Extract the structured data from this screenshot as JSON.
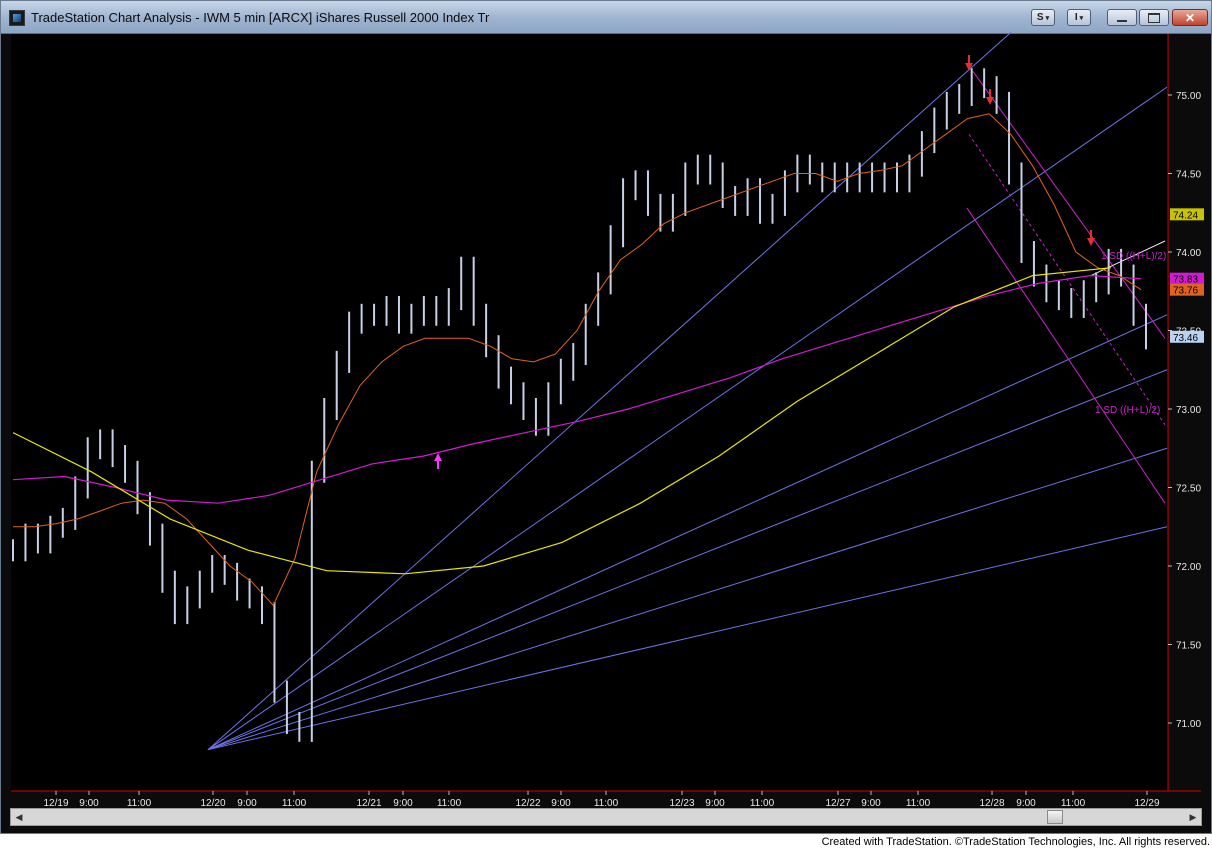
{
  "window": {
    "title": "TradeStation Chart Analysis - IWM 5 min [ARCX] iShares Russell 2000 Index Tr",
    "buttons": {
      "symbol_menu": "S",
      "toolbar_menu": "I"
    }
  },
  "footer": {
    "credit": "Created with TradeStation. ©TradeStation Technologies, Inc. All rights reserved."
  },
  "colors": {
    "background": "#000000",
    "bars": "#c7d1e6",
    "ema_orange": "#e0621f",
    "ma_magenta": "#d21ad2",
    "regression_yellow": "#e6e600",
    "fan_lines": "#6c74e6",
    "channel_magenta": "#cc22cc",
    "plot_border": "#d80000",
    "signal_up": "#ff33ff",
    "signal_down": "#e03030"
  },
  "chart_data": {
    "type": "line",
    "symbol": "IWM",
    "interval": "5 min",
    "ylim": [
      70.6,
      75.4
    ],
    "y_ticks": [
      "75.00",
      "74.50",
      "74.00",
      "73.50",
      "73.00",
      "72.50",
      "72.00",
      "71.50",
      "71.00"
    ],
    "x_ticks": [
      "12/19",
      "9:00",
      "11:00",
      "12/20",
      "9:00",
      "11:00",
      "12/21",
      "9:00",
      "11:00",
      "12/22",
      "9:00",
      "11:00",
      "12/23",
      "9:00",
      "11:00",
      "12/27",
      "9:00",
      "11:00",
      "12/28",
      "9:00",
      "11:00",
      "12/29"
    ],
    "price_badges": [
      {
        "label": "74.24",
        "value": 74.24,
        "color": "#c9c200"
      },
      {
        "label": "73.83",
        "value": 73.83,
        "color": "#d21ad2"
      },
      {
        "label": "73.76",
        "value": 73.76,
        "color": "#e0621f"
      },
      {
        "label": "73.46",
        "value": 73.46,
        "color": "#b9d3f3"
      }
    ],
    "annotations": [
      "1 SD ((H+L)/2)",
      "1 SD ((H+L)/2)"
    ],
    "series": [
      {
        "name": "",
        "role": "price",
        "values": [
          72.1,
          72.2,
          72.15,
          72.25,
          72.3,
          72.5,
          72.75,
          72.8,
          72.7,
          72.6,
          72.4,
          72.2,
          71.9,
          71.7,
          71.8,
          71.9,
          72.0,
          71.95,
          71.85,
          71.8,
          71.7,
          71.2,
          71.0,
          70.95,
          72.6,
          73.0,
          73.3,
          73.55,
          73.6,
          73.6,
          73.65,
          73.55,
          73.6,
          73.65,
          73.6,
          73.7,
          73.9,
          73.6,
          73.4,
          73.2,
          73.1,
          73.0,
          72.9,
          73.1,
          73.25,
          73.35,
          73.6,
          73.8,
          74.1,
          74.4,
          74.45,
          74.3,
          74.2,
          74.3,
          74.5,
          74.55,
          74.5,
          74.35,
          74.3,
          74.4,
          74.25,
          74.3,
          74.45,
          74.55,
          74.5,
          74.45,
          74.5,
          74.45,
          74.5,
          74.45,
          74.5,
          74.45,
          74.55,
          74.7,
          74.85,
          74.95,
          75.0,
          75.1,
          75.05,
          74.95,
          74.5,
          74.0,
          73.85,
          73.75,
          73.7,
          73.65,
          73.75,
          73.8,
          73.95,
          73.85,
          73.6,
          73.45
        ]
      },
      {
        "name": "",
        "role": "ema_orange",
        "values": [
          72.25,
          72.25,
          72.27,
          72.3,
          72.35,
          72.4,
          72.42,
          72.4,
          72.3,
          72.15,
          72.0,
          71.9,
          71.75,
          72.05,
          72.6,
          72.9,
          73.15,
          73.3,
          73.4,
          73.45,
          73.45,
          73.45,
          73.4,
          73.32,
          73.3,
          73.35,
          73.5,
          73.75,
          73.95,
          74.05,
          74.18,
          74.25,
          74.3,
          74.35,
          74.4,
          74.45,
          74.5,
          74.5,
          74.45,
          74.5,
          74.52,
          74.55,
          74.65,
          74.75,
          74.85,
          74.88,
          74.75,
          74.55,
          74.3,
          74.0,
          73.9,
          73.85,
          73.76
        ]
      },
      {
        "name": "",
        "role": "ma_magenta",
        "values": [
          72.55,
          72.57,
          72.5,
          72.42,
          72.4,
          72.45,
          72.55,
          72.65,
          72.7,
          72.78,
          72.85,
          72.92,
          73.0,
          73.1,
          73.2,
          73.32,
          73.42,
          73.52,
          73.62,
          73.72,
          73.8,
          73.85,
          73.83
        ]
      },
      {
        "name": "",
        "role": "regression_yellow",
        "values": [
          72.85,
          72.6,
          72.3,
          72.1,
          71.97,
          71.95,
          72.0,
          72.15,
          72.4,
          72.7,
          73.05,
          73.35,
          73.65,
          73.85,
          73.9
        ]
      }
    ]
  }
}
